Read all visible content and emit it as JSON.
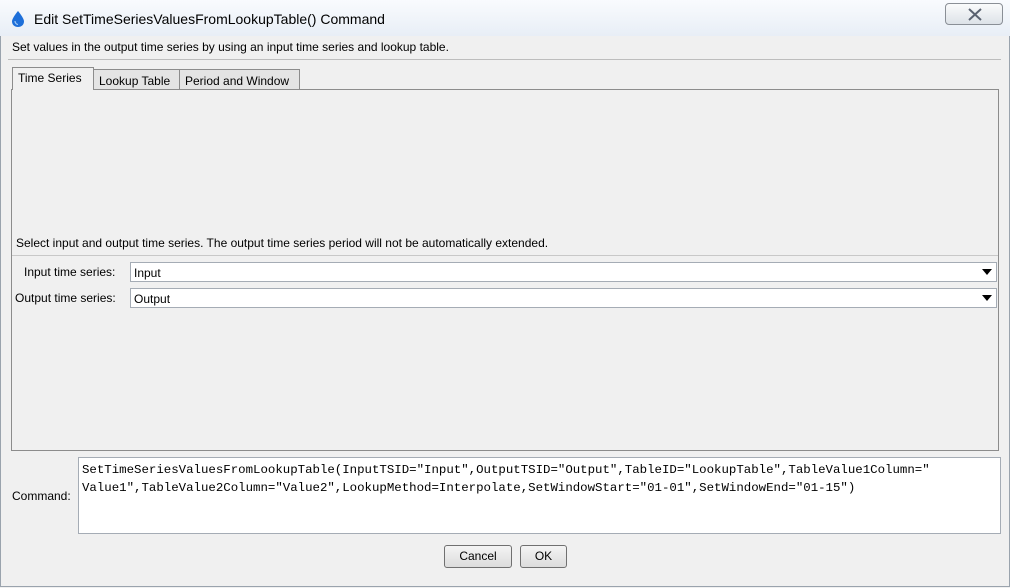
{
  "window": {
    "title": "Edit SetTimeSeriesValuesFromLookupTable() Command",
    "icon": "water-drop-icon",
    "close_icon": "close-x-icon"
  },
  "intro_text": "Set values in the output time series by using an input time series and lookup table.",
  "tabs": [
    {
      "label": "Time Series",
      "active": true
    },
    {
      "label": "Lookup Table",
      "active": false
    },
    {
      "label": "Period and Window",
      "active": false
    }
  ],
  "time_series_tab": {
    "description": "Select input and output time series.  The output time series period will not be automatically extended.",
    "input": {
      "label": "Input time series:",
      "value": "Input"
    },
    "output": {
      "label": "Output time series:",
      "value": "Output"
    }
  },
  "command": {
    "label": "Command:",
    "text": "SetTimeSeriesValuesFromLookupTable(InputTSID=\"Input\",OutputTSID=\"Output\",TableID=\"LookupTable\",TableValue1Column=\"\nValue1\",TableValue2Column=\"Value2\",LookupMethod=Interpolate,SetWindowStart=\"01-01\",SetWindowEnd=\"01-15\")"
  },
  "buttons": {
    "cancel": "Cancel",
    "ok": "OK"
  },
  "colors": {
    "background": "#f0f0f0",
    "border": "#8c8c8c",
    "icon_blue": "#1e6fd9"
  }
}
